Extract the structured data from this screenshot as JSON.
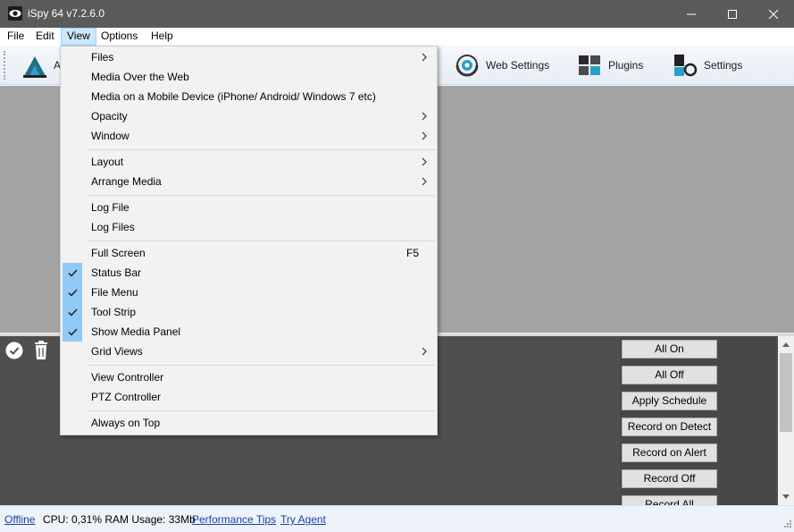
{
  "window": {
    "title": "iSpy 64 v7.2.6.0"
  },
  "menubar": {
    "items": [
      {
        "label": "File"
      },
      {
        "label": "Edit"
      },
      {
        "label": "View"
      },
      {
        "label": "Options"
      },
      {
        "label": "Help"
      }
    ]
  },
  "toolbar": {
    "add_label": "A",
    "web_settings_label": "Web Settings",
    "plugins_label": "Plugins",
    "settings_label": "Settings"
  },
  "view_menu": {
    "items": {
      "files": {
        "label": "Files"
      },
      "media_web": {
        "label": "Media Over the Web"
      },
      "media_mobile": {
        "label": "Media on a Mobile Device (iPhone/ Android/ Windows 7 etc)"
      },
      "opacity": {
        "label": "Opacity"
      },
      "window": {
        "label": "Window"
      },
      "layout": {
        "label": "Layout"
      },
      "arrange_media": {
        "label": "Arrange Media"
      },
      "log_file": {
        "label": "Log File"
      },
      "log_files": {
        "label": "Log Files"
      },
      "full_screen": {
        "label": "Full Screen",
        "shortcut": "F5"
      },
      "status_bar": {
        "label": "Status Bar",
        "checked": true
      },
      "file_menu": {
        "label": "File Menu",
        "checked": true
      },
      "tool_strip": {
        "label": "Tool Strip",
        "checked": true
      },
      "show_media_panel": {
        "label": "Show Media Panel",
        "checked": true
      },
      "grid_views": {
        "label": "Grid Views"
      },
      "view_controller": {
        "label": "View Controller"
      },
      "ptz_controller": {
        "label": "PTZ Controller"
      },
      "always_on_top": {
        "label": "Always on Top"
      }
    }
  },
  "command_panel": {
    "buttons": [
      {
        "label": "All On"
      },
      {
        "label": "All Off"
      },
      {
        "label": "Apply Schedule"
      },
      {
        "label": "Record on Detect"
      },
      {
        "label": "Record on Alert"
      },
      {
        "label": "Record Off"
      },
      {
        "label": "Record All"
      }
    ]
  },
  "statusbar": {
    "offline": "Offline",
    "stats": "CPU: 0,31% RAM Usage: 33Mb",
    "performance_tips": "Performance Tips",
    "try_agent": "Try Agent"
  },
  "colors": {
    "titlebar": "#5a5a5a",
    "canvas": "#a3a3a3",
    "lower_panel": "#4f4f4f",
    "check_highlight": "#90c8f6",
    "link": "#1a3fa8"
  }
}
